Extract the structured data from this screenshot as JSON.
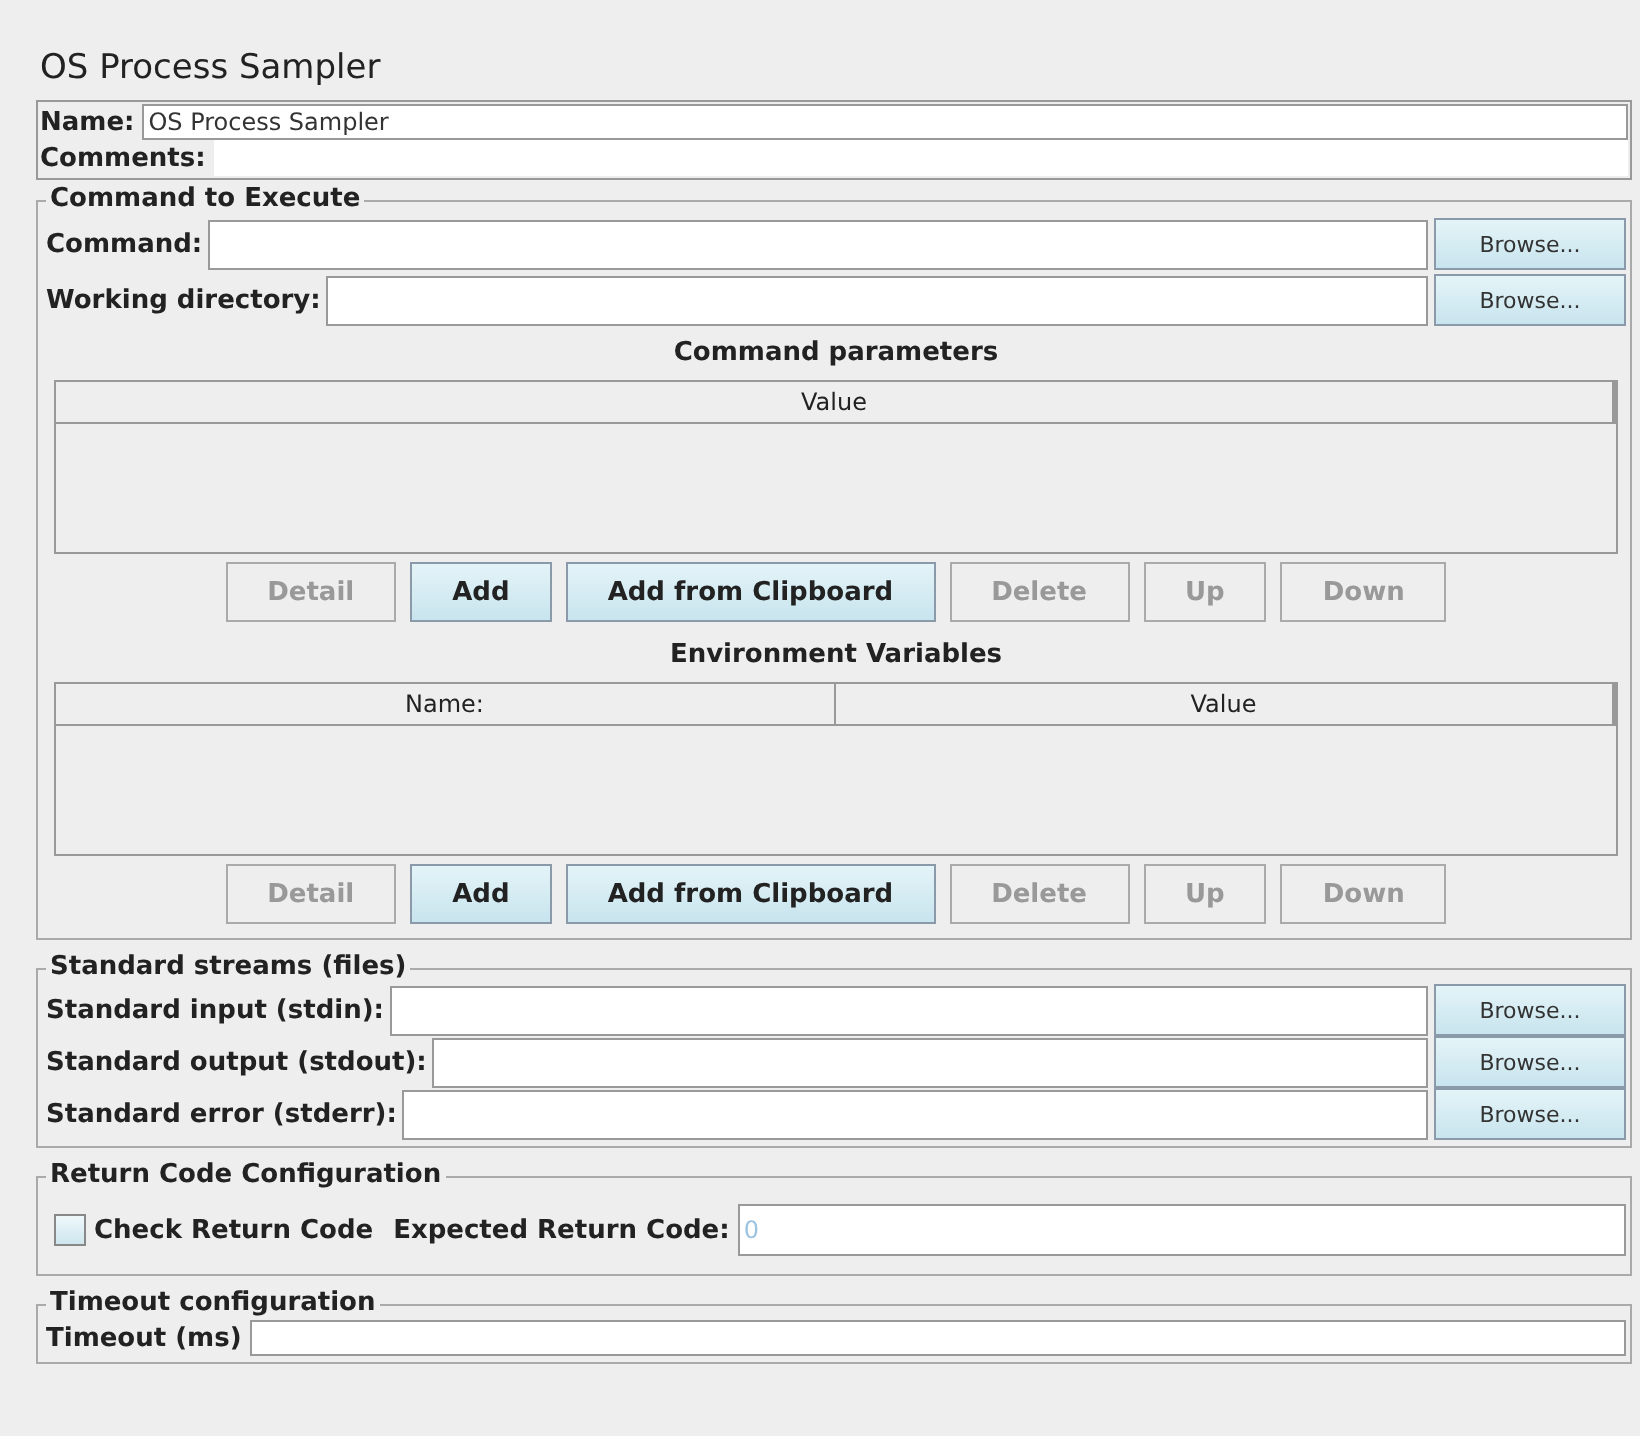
{
  "title": "OS Process Sampler",
  "name_field": {
    "label": "Name:",
    "value": "OS Process Sampler"
  },
  "comments_field": {
    "label": "Comments:"
  },
  "command_section": {
    "legend": "Command to Execute",
    "fields": [
      {
        "label": "Command:",
        "button": "Browse..."
      },
      {
        "label": "Working directory:",
        "button": "Browse..."
      }
    ],
    "tables": [
      {
        "heading": "Command parameters",
        "columns": [
          "Value"
        ],
        "buttons": [
          {
            "label": "Detail",
            "disabled": true
          },
          {
            "label": "Add",
            "disabled": false
          },
          {
            "label": "Add from Clipboard",
            "disabled": false
          },
          {
            "label": "Delete",
            "disabled": true
          },
          {
            "label": "Up",
            "disabled": true
          },
          {
            "label": "Down",
            "disabled": true
          }
        ]
      },
      {
        "heading": "Environment Variables",
        "columns": [
          "Name:",
          "Value"
        ],
        "buttons": [
          {
            "label": "Detail",
            "disabled": true
          },
          {
            "label": "Add",
            "disabled": false
          },
          {
            "label": "Add from Clipboard",
            "disabled": false
          },
          {
            "label": "Delete",
            "disabled": true
          },
          {
            "label": "Up",
            "disabled": true
          },
          {
            "label": "Down",
            "disabled": true
          }
        ]
      }
    ]
  },
  "streams_section": {
    "legend": "Standard streams (files)",
    "fields": [
      {
        "label": "Standard input (stdin):",
        "button": "Browse..."
      },
      {
        "label": "Standard output (stdout):",
        "button": "Browse..."
      },
      {
        "label": "Standard error (stderr):",
        "button": "Browse..."
      }
    ]
  },
  "return_code_section": {
    "legend": "Return Code Configuration",
    "checkbox": {
      "label": "Check Return Code",
      "checked": false
    },
    "expected": {
      "label": "Expected Return Code:",
      "value": "0",
      "disabled": true
    }
  },
  "timeout_section": {
    "legend": "Timeout configuration",
    "label": "Timeout (ms)"
  }
}
